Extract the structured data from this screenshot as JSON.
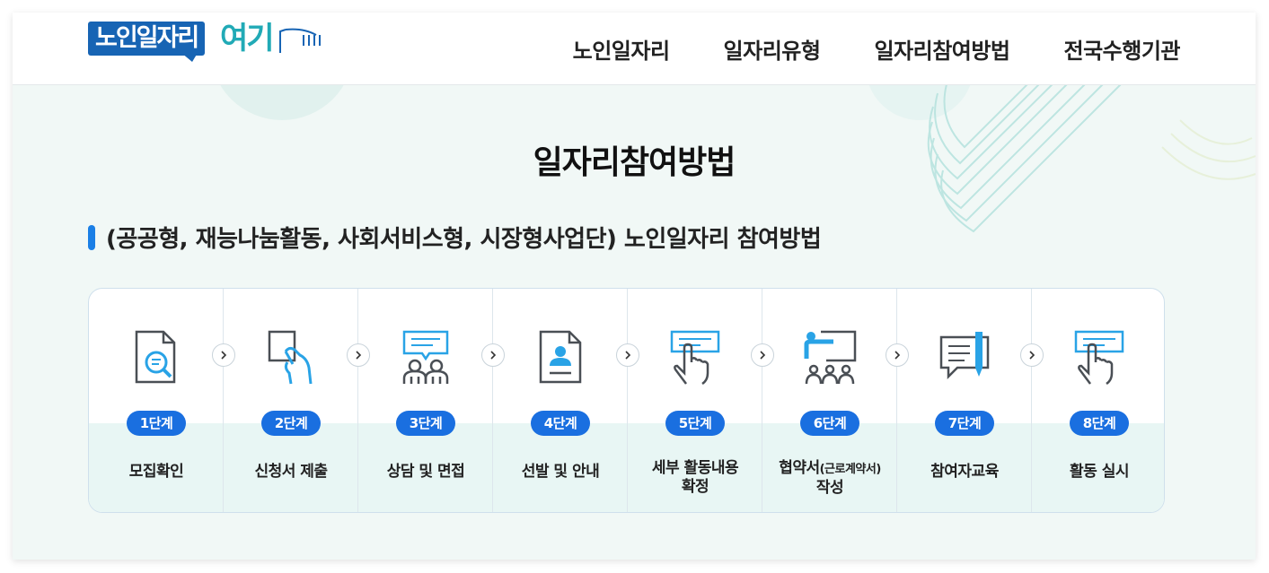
{
  "logo": {
    "text": "노인일자리",
    "accent": "여기"
  },
  "nav": [
    "노인일자리",
    "일자리유형",
    "일자리참여방법",
    "전국수행기관"
  ],
  "page_title": "일자리참여방법",
  "subtitle": "(공공형, 재능나눔활동, 사회서비스형, 시장형사업단) 노인일자리 참여방법",
  "colors": {
    "primary": "#1a6fe0",
    "logo_blue": "#1764b4",
    "teal": "#21aab6",
    "icon_blue": "#29a3e6",
    "icon_dark": "#4a4f55"
  },
  "steps": [
    {
      "badge": "1단계",
      "label_1": "모집확인",
      "label_2": "",
      "icon": "document-search-icon"
    },
    {
      "badge": "2단계",
      "label_1": "신청서 제출",
      "label_2": "",
      "icon": "hand-submit-document-icon"
    },
    {
      "badge": "3단계",
      "label_1": "상담 및 면접",
      "label_2": "",
      "icon": "interview-people-icon"
    },
    {
      "badge": "4단계",
      "label_1": "선발 및 안내",
      "label_2": "",
      "icon": "profile-document-icon"
    },
    {
      "badge": "5단계",
      "label_1": "세부 활동내용",
      "label_2": "확정",
      "icon": "touch-screen-icon"
    },
    {
      "badge": "6단계",
      "label_1": "협약서",
      "label_1_small": "(근로계약서)",
      "label_2": "작성",
      "icon": "presentation-board-icon"
    },
    {
      "badge": "7단계",
      "label_1": "참여자교육",
      "label_2": "",
      "icon": "speech-pen-icon"
    },
    {
      "badge": "8단계",
      "label_1": "활동 실시",
      "label_2": "",
      "icon": "touch-screen-icon"
    }
  ]
}
